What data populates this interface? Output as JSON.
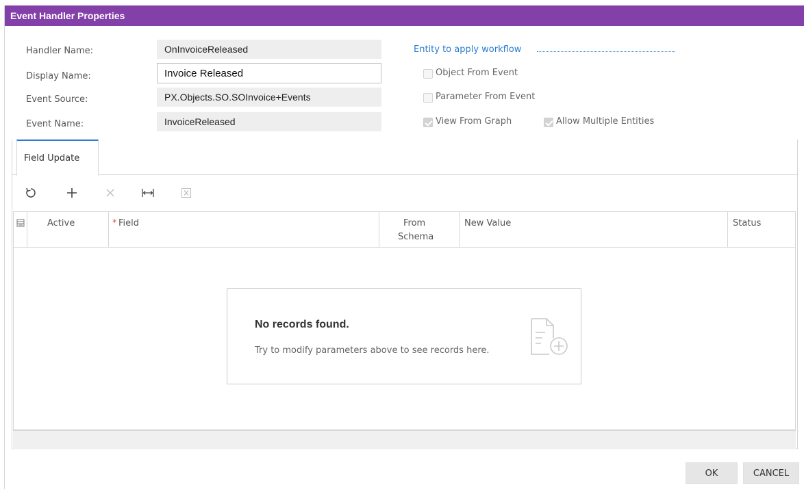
{
  "dialog": {
    "title": "Event Handler Properties",
    "accent_color": "#8440a9",
    "link_color": "#2b7bd1"
  },
  "form": {
    "handler_name": {
      "label": "Handler Name:",
      "value": "OnInvoiceReleased"
    },
    "display_name": {
      "label": "Display Name:",
      "value": "Invoice Released"
    },
    "event_source": {
      "label": "Event Source:",
      "value": "PX.Objects.SO.SOInvoice+Events"
    },
    "event_name": {
      "label": "Event Name:",
      "value": "InvoiceReleased"
    }
  },
  "entity": {
    "legend": "Entity to apply workflow",
    "object_from_event": {
      "label": "Object From Event",
      "checked": false,
      "enabled": false
    },
    "parameter_from_event": {
      "label": "Parameter From Event",
      "checked": false,
      "enabled": false
    },
    "view_from_graph": {
      "label": "View From Graph",
      "checked": true,
      "enabled": false
    },
    "allow_multiple_entities": {
      "label": "Allow Multiple Entities",
      "checked": true,
      "enabled": false
    }
  },
  "tabs": [
    {
      "label": "Field Update",
      "active": true
    }
  ],
  "toolbar": {
    "refresh": {
      "icon": "refresh-icon",
      "enabled": true
    },
    "add": {
      "icon": "plus-icon",
      "enabled": true
    },
    "delete": {
      "icon": "close-icon",
      "enabled": false
    },
    "fit_columns": {
      "icon": "fit-width-icon",
      "enabled": true
    },
    "export_excel": {
      "icon": "excel-icon",
      "enabled": false
    }
  },
  "grid": {
    "columns": {
      "active": "Active",
      "field_required_mark": "*",
      "field": "Field",
      "from_schema_line1": "From",
      "from_schema_line2": "Schema",
      "new_value": "New Value",
      "status": "Status"
    },
    "rows": [],
    "empty_title": "No records found.",
    "empty_message": "Try to modify parameters above to see records here."
  },
  "buttons": {
    "ok": "OK",
    "cancel": "CANCEL"
  }
}
